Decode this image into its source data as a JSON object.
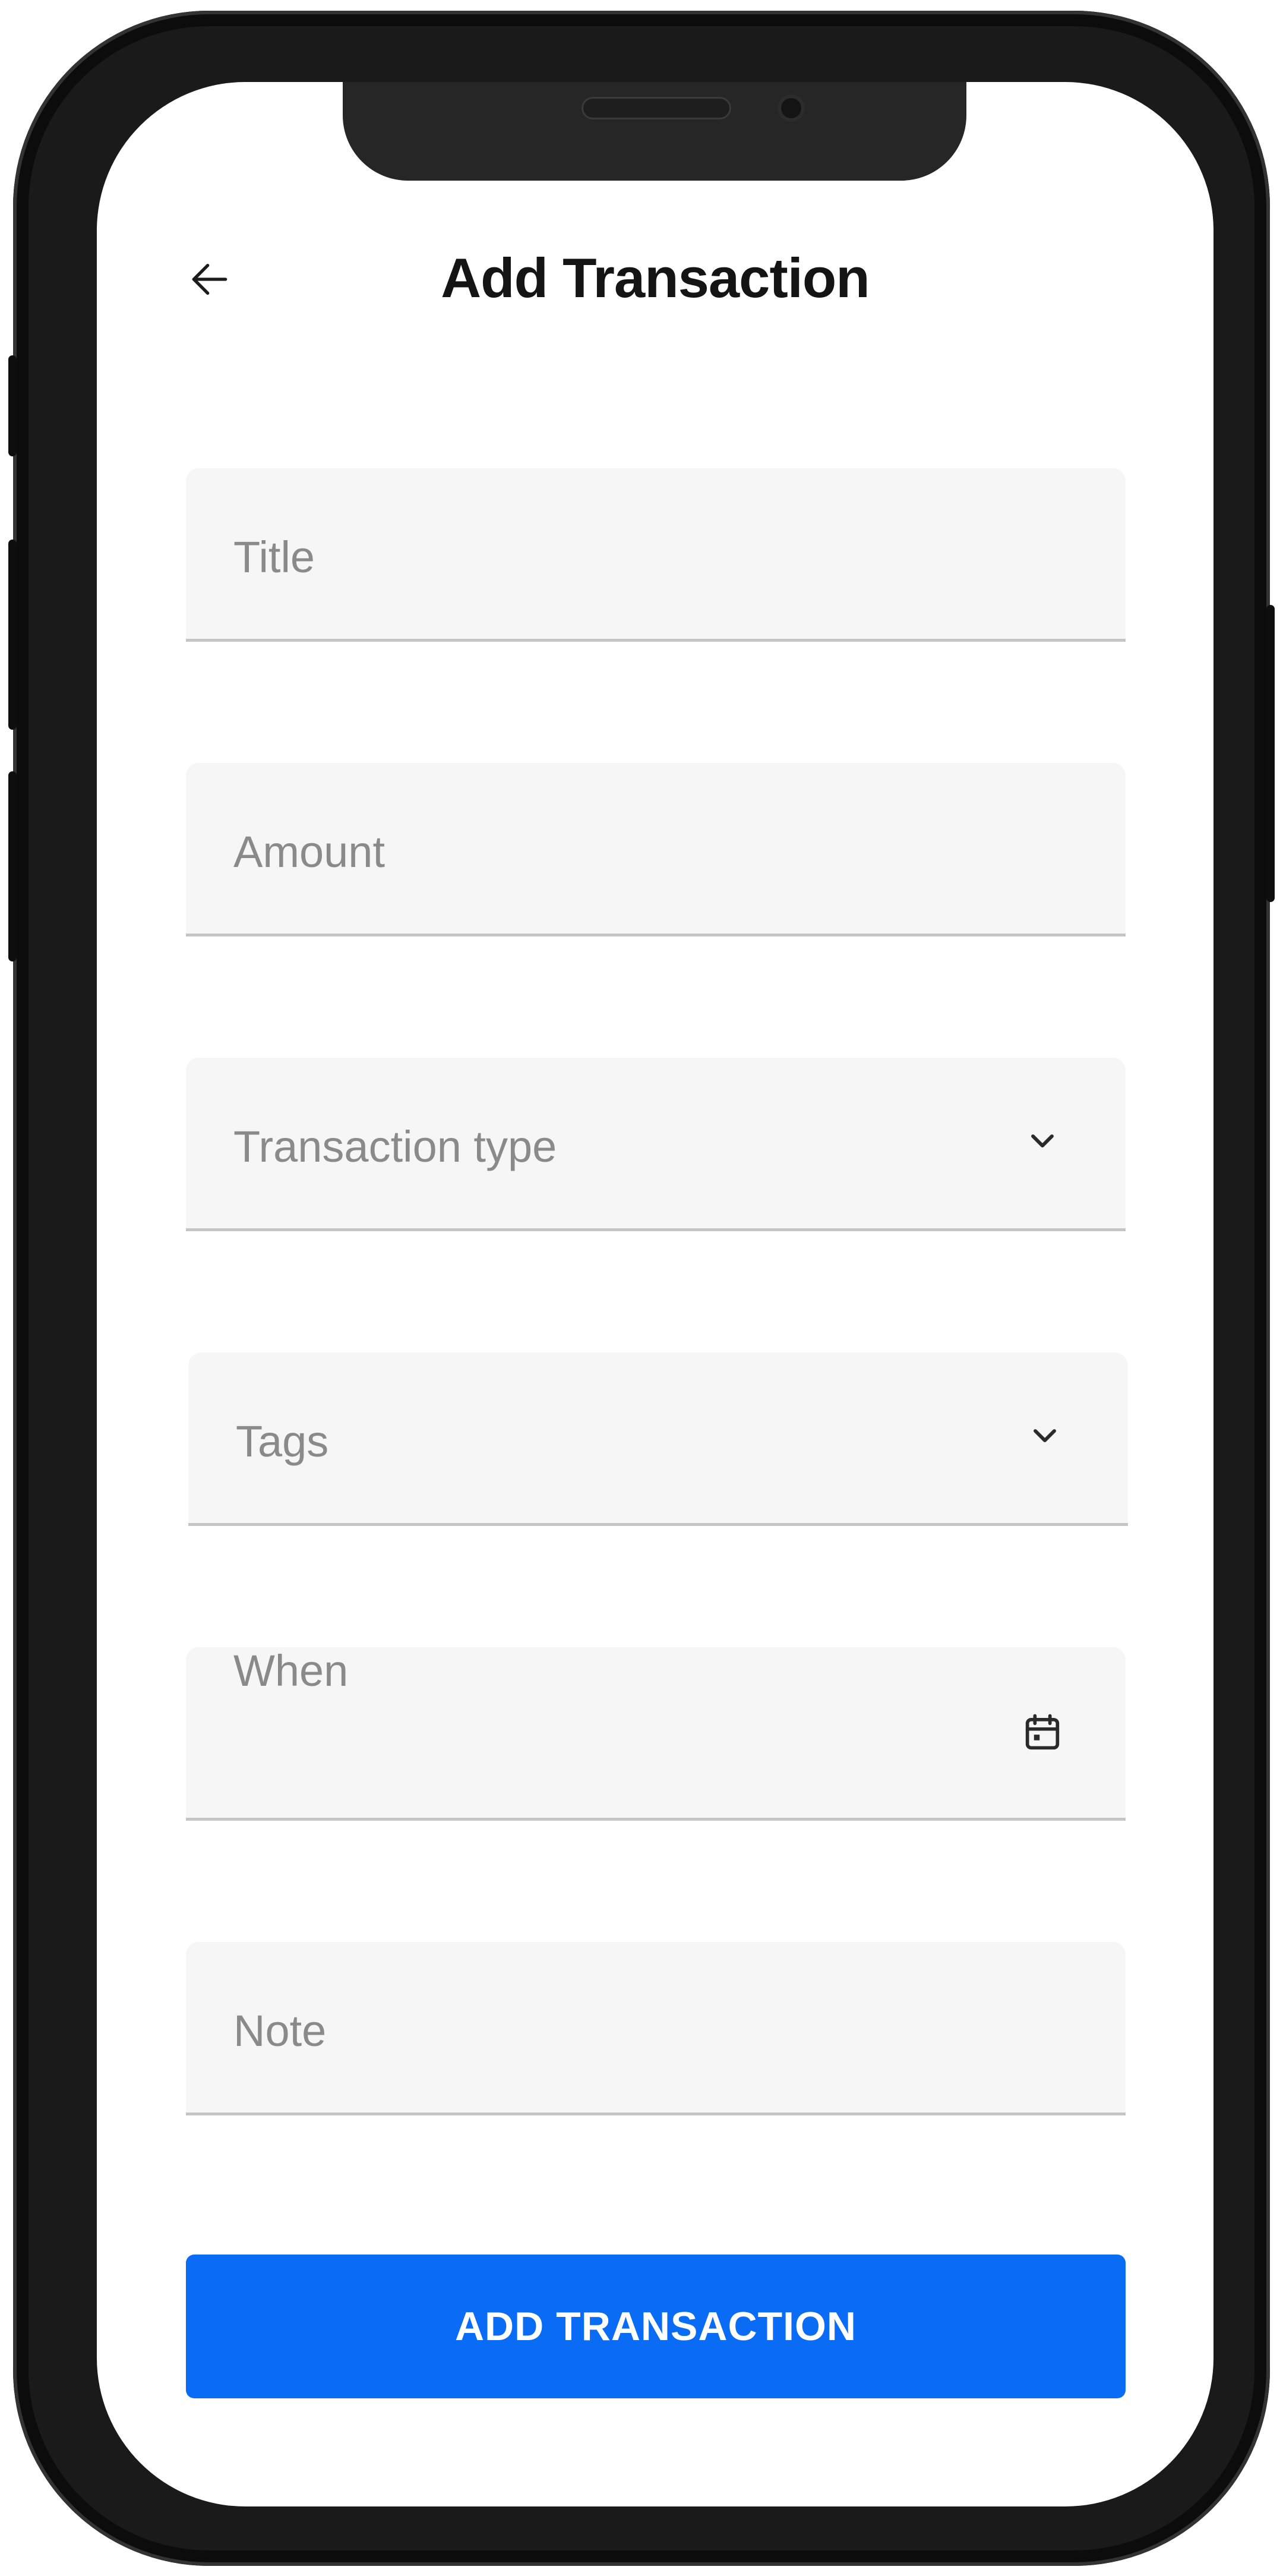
{
  "header": {
    "title": "Add Transaction",
    "back_icon": "arrow-left-icon"
  },
  "form": {
    "fields": [
      {
        "label": "Title",
        "type": "text"
      },
      {
        "label": "Amount",
        "type": "number"
      },
      {
        "label": "Transaction type",
        "type": "select",
        "icon": "chevron-down-icon"
      },
      {
        "label": "Tags",
        "type": "select",
        "icon": "chevron-down-icon"
      },
      {
        "label": "When",
        "type": "date",
        "icon": "calendar-icon"
      },
      {
        "label": "Note",
        "type": "text"
      }
    ],
    "submit_label": "ADD TRANSACTION"
  },
  "colors": {
    "accent": "#0a6bf5",
    "field_background": "#f6f6f6",
    "field_underline": "#c6c6c6",
    "label_text": "#8a8a8a",
    "title_text": "#141414"
  }
}
